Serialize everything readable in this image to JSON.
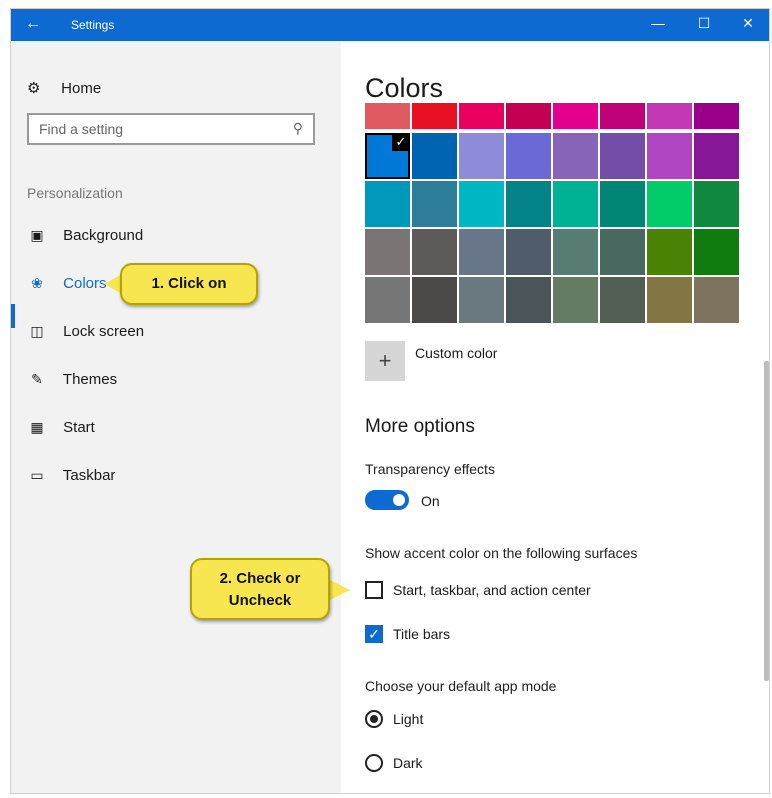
{
  "window": {
    "title": "Settings",
    "back_icon": "back-arrow-icon",
    "controls": [
      "minimize",
      "maximize",
      "close"
    ]
  },
  "sidebar": {
    "home_label": "Home",
    "search_placeholder": "Find a setting",
    "section_label": "Personalization",
    "items": [
      {
        "label": "Background",
        "icon": "background-icon"
      },
      {
        "label": "Colors",
        "icon": "palette-icon",
        "active": true
      },
      {
        "label": "Lock screen",
        "icon": "lock-screen-icon"
      },
      {
        "label": "Themes",
        "icon": "themes-icon"
      },
      {
        "label": "Start",
        "icon": "start-icon"
      },
      {
        "label": "Taskbar",
        "icon": "taskbar-icon"
      }
    ]
  },
  "main": {
    "heading": "Colors",
    "palette": [
      [
        "#e05a61",
        "#e81123",
        "#ea005e",
        "#c30052",
        "#e3008c",
        "#bf0077",
        "#c239b3",
        "#9a0089"
      ],
      [
        "#0078d7",
        "#0063b1",
        "#8e8cd8",
        "#6b69d6",
        "#8764b8",
        "#744da9",
        "#b146c2",
        "#881798"
      ],
      [
        "#0099bc",
        "#2d7d9a",
        "#00b7c3",
        "#038387",
        "#00b294",
        "#018574",
        "#00cc6a",
        "#10893e"
      ],
      [
        "#7a7574",
        "#5d5a58",
        "#68768a",
        "#515c6b",
        "#567c73",
        "#486860",
        "#498205",
        "#107c10"
      ],
      [
        "#767676",
        "#4c4a48",
        "#69797e",
        "#4a5459",
        "#647c64",
        "#525e54",
        "#847545",
        "#7e735f"
      ]
    ],
    "selected_swatch": "row 2, column 1",
    "custom_color_label": "Custom color",
    "more_options_heading": "More options",
    "transparency_label": "Transparency effects",
    "transparency_state": "On",
    "accent_surfaces_label": "Show accent color on the following surfaces",
    "checkbox_start_label": "Start, taskbar, and action center",
    "checkbox_start_checked": false,
    "checkbox_titlebars_label": "Title bars",
    "checkbox_titlebars_checked": true,
    "app_mode_label": "Choose your default app mode",
    "radio_light_label": "Light",
    "radio_dark_label": "Dark",
    "app_mode_selected": "Light"
  },
  "callouts": {
    "click_on": "1. Click on",
    "check_line1": "2. Check or",
    "check_line2": "Uncheck"
  },
  "colors": {
    "accent": "#0d6ad3",
    "callout": "#f7e650"
  }
}
